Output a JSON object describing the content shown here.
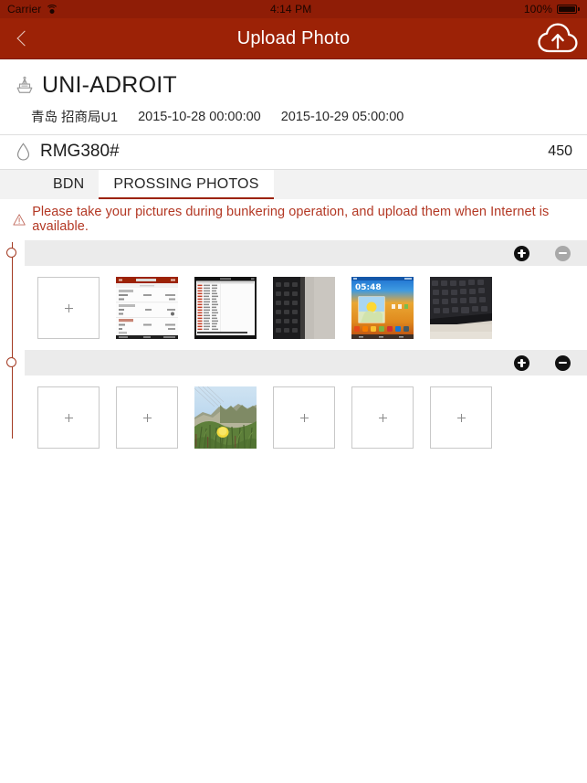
{
  "status_bar": {
    "carrier": "Carrier",
    "wifi_icon": "wifi-icon",
    "time": "4:14 PM",
    "battery_percent": "100%",
    "battery_icon": "battery-full-icon"
  },
  "nav_bar": {
    "back_icon": "chevron-left-icon",
    "title": "Upload Photo",
    "upload_icon": "cloud-upload-icon"
  },
  "vessel": {
    "ship_icon": "ship-icon",
    "name": "UNI-ADROIT",
    "port": "青岛 招商局U1",
    "start_time": "2015-10-28 00:00:00",
    "end_time": "2015-10-29 05:00:00"
  },
  "fuel": {
    "droplet_icon": "droplet-icon",
    "grade": "RMG380#",
    "quantity": "450"
  },
  "tabs": [
    {
      "label": "BDN",
      "active": false
    },
    {
      "label": "PROSSING PHOTOS",
      "active": true
    }
  ],
  "warning": {
    "icon": "warning-triangle-icon",
    "text": "Please take your pictures during bunkering operation, and upload them when Internet is available."
  },
  "groups": [
    {
      "add_icon": "plus-circle-icon",
      "add_state": "dark",
      "remove_icon": "minus-circle-icon",
      "remove_state": "gray",
      "thumbs": [
        {
          "kind": "empty",
          "label": "add-photo-placeholder"
        },
        {
          "kind": "photo",
          "label": "app-form-screenshot"
        },
        {
          "kind": "photo",
          "label": "data-table-screenshot"
        },
        {
          "kind": "photo",
          "label": "keyboard-edge-photo"
        },
        {
          "kind": "photo",
          "label": "android-homescreen-photo"
        },
        {
          "kind": "photo",
          "label": "keyboard-desk-photo"
        }
      ]
    },
    {
      "add_icon": "plus-circle-icon",
      "add_state": "dark",
      "remove_icon": "minus-circle-icon",
      "remove_state": "dark",
      "thumbs": [
        {
          "kind": "empty",
          "label": "add-photo-placeholder"
        },
        {
          "kind": "empty",
          "label": "add-photo-placeholder"
        },
        {
          "kind": "photo",
          "label": "landscape-flower-photo"
        },
        {
          "kind": "empty",
          "label": "add-photo-placeholder"
        },
        {
          "kind": "empty",
          "label": "add-photo-placeholder"
        },
        {
          "kind": "empty",
          "label": "add-photo-placeholder"
        }
      ]
    }
  ],
  "colors": {
    "status_bar": "#8F1D06",
    "nav_bar": "#9C2206",
    "accent": "#9C2206",
    "warning_text": "#b33824",
    "timeline": "#a33a22",
    "group_header": "#ebebeb"
  }
}
